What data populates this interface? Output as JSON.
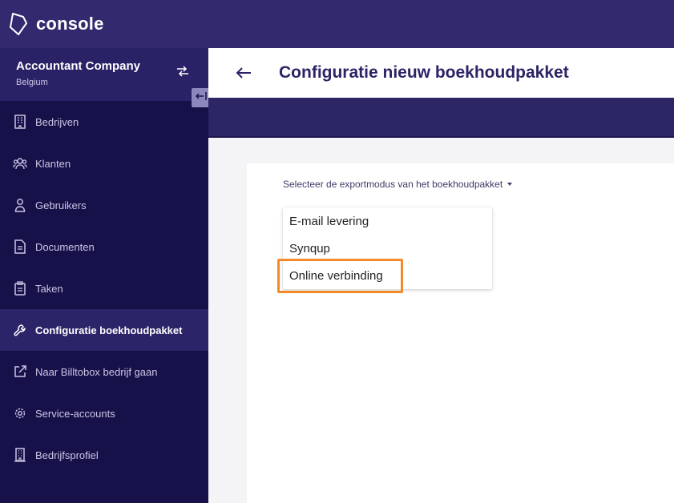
{
  "app": {
    "name": "console"
  },
  "company": {
    "name": "Accountant Company",
    "country": "Belgium"
  },
  "sidebar": {
    "items": [
      {
        "label": "Bedrijven",
        "icon": "building-icon"
      },
      {
        "label": "Klanten",
        "icon": "users-group-icon"
      },
      {
        "label": "Gebruikers",
        "icon": "user-icon"
      },
      {
        "label": "Documenten",
        "icon": "document-icon"
      },
      {
        "label": "Taken",
        "icon": "clipboard-icon"
      },
      {
        "label": "Configuratie boekhoudpakket",
        "icon": "wrench-icon",
        "active": true
      },
      {
        "label": "Naar Billtobox bedrijf gaan",
        "icon": "external-link-icon"
      },
      {
        "label": "Service-accounts",
        "icon": "cog-icon"
      },
      {
        "label": "Bedrijfsprofiel",
        "icon": "office-building-icon"
      }
    ]
  },
  "header": {
    "title": "Configuratie nieuw boekhoudpakket"
  },
  "form": {
    "select_label": "Selecteer de exportmodus van het boekhoudpakket",
    "options": [
      "E-mail levering",
      "Synqup",
      "Online verbinding"
    ],
    "highlighted_option": "Online verbinding"
  },
  "colors": {
    "topbar": "#33296f",
    "sidebar": "#17114a",
    "active_item": "#2c2468",
    "title": "#2b2466",
    "highlight": "#f28a2a"
  }
}
